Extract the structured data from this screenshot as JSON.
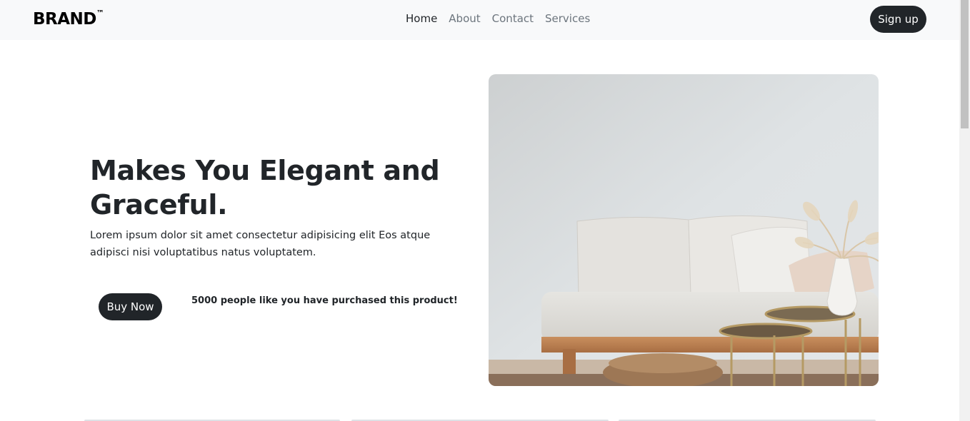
{
  "navbar": {
    "brand": "BRAND",
    "brand_mark": "™",
    "links": [
      {
        "label": "Home",
        "active": true
      },
      {
        "label": "About",
        "active": false
      },
      {
        "label": "Contact",
        "active": false
      },
      {
        "label": "Services",
        "active": false
      }
    ],
    "signup_label": "Sign up"
  },
  "hero": {
    "title": "Makes You Elegant and Graceful.",
    "text": "Lorem ipsum dolor sit amet consectetur adipisicing elit Eos atque adipisci nisi voluptatibus natus voluptatem.",
    "buy_label": "Buy Now",
    "purchase_note": "5000 people like you have purchased this product!"
  },
  "colors": {
    "navbar_bg": "#f8f9fa",
    "button_bg": "#212529",
    "text": "#212529",
    "muted_link": "#6c757d"
  }
}
